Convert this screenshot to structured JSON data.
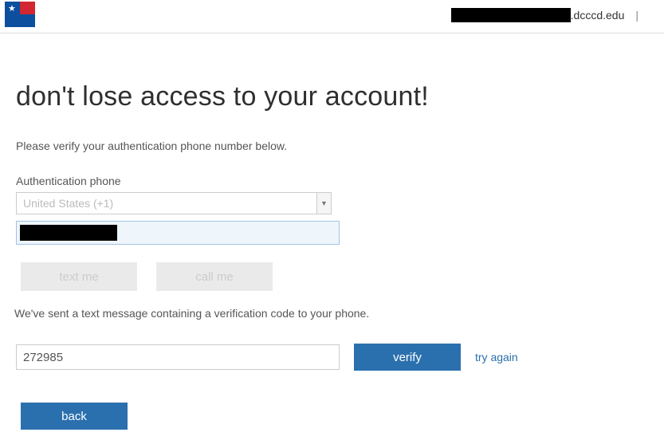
{
  "header": {
    "domain_suffix": ".dcccd.edu",
    "divider": "|"
  },
  "page": {
    "title": "don't lose access to your account!",
    "instruction": "Please verify your authentication phone number below.",
    "auth_phone_label": "Authentication phone",
    "country_selected": "United States (+1)",
    "text_me_label": "text me",
    "call_me_label": "call me",
    "sent_message": "We've sent a text message containing a verification code to your phone.",
    "code_value": "272985",
    "verify_label": "verify",
    "try_again_label": "try again",
    "back_label": "back"
  }
}
